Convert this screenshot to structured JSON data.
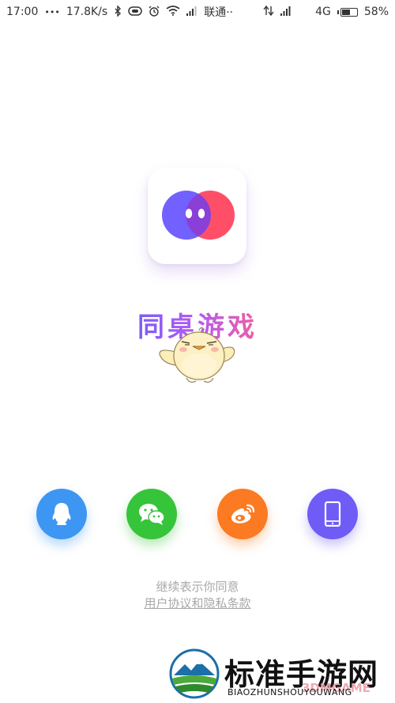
{
  "status_bar": {
    "time": "17:00",
    "dots": "•••",
    "speed": "17.8K/s",
    "carrier": "联通··",
    "network": "4G",
    "battery": "58%",
    "battery_level": 0.58,
    "icons": [
      "bluetooth-icon",
      "vr-icon",
      "alarm-icon",
      "wifi-icon",
      "signal-icon",
      "data-transfer-icon",
      "signal-icon-2"
    ]
  },
  "app": {
    "title": "同桌游戏",
    "icon_colors": {
      "left": "#6c5bff",
      "right": "#ff4f68"
    }
  },
  "login": {
    "buttons": [
      {
        "name": "qq-login-button",
        "icon": "qq-penguin-icon",
        "color": "#3e96f3"
      },
      {
        "name": "wechat-login-button",
        "icon": "wechat-icon",
        "color": "#36c43a"
      },
      {
        "name": "weibo-login-button",
        "icon": "weibo-icon",
        "color": "#fb7a22"
      },
      {
        "name": "phone-login-button",
        "icon": "phone-icon",
        "color": "#6f5cf7"
      }
    ]
  },
  "agreement": {
    "prefix": "继续表示你同意",
    "link": "用户协议和隐私条款"
  },
  "watermark": {
    "title": "标准手游网",
    "subtitle": "BIAOZHUNSHOUYOUWANG",
    "tag": "3DMGAME"
  }
}
